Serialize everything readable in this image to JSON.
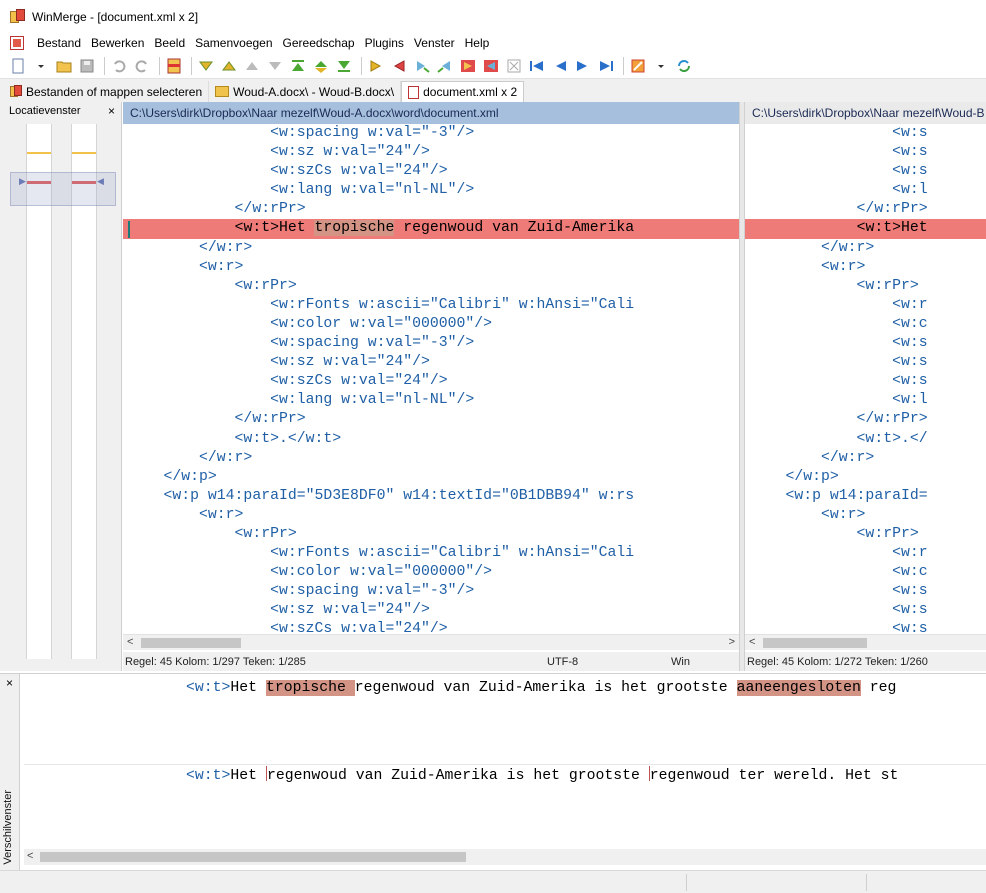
{
  "window": {
    "title": "WinMerge - [document.xml x 2]"
  },
  "menu": [
    "Bestand",
    "Bewerken",
    "Beeld",
    "Samenvoegen",
    "Gereedschap",
    "Plugins",
    "Venster",
    "Help"
  ],
  "tabs": [
    {
      "label": "Bestanden of mappen selecteren",
      "icon": "winmerge-icon"
    },
    {
      "label": "Woud-A.docx\\ - Woud-B.docx\\",
      "icon": "folder-icon"
    },
    {
      "label": "document.xml x 2",
      "icon": "document-icon",
      "active": true
    }
  ],
  "location_pane": {
    "title": "Locatievenster",
    "close": "×"
  },
  "left": {
    "path": "C:\\Users\\dirk\\Dropbox\\Naar mezelf\\Woud-A.docx\\word\\document.xml",
    "lines": [
      "                <w:spacing w:val=\"-3\"/>",
      "                <w:sz w:val=\"24\"/>",
      "                <w:szCs w:val=\"24\"/>",
      "                <w:lang w:val=\"nl-NL\"/>",
      "            </w:rPr>",
      "",
      "        </w:r>",
      "        <w:r>",
      "            <w:rPr>",
      "                <w:rFonts w:ascii=\"Calibri\" w:hAnsi=\"Cali",
      "                <w:color w:val=\"000000\"/>",
      "                <w:spacing w:val=\"-3\"/>",
      "                <w:sz w:val=\"24\"/>",
      "                <w:szCs w:val=\"24\"/>",
      "                <w:lang w:val=\"nl-NL\"/>",
      "            </w:rPr>",
      "            <w:t>.</w:t>",
      "        </w:r>",
      "    </w:p>",
      "    <w:p w14:paraId=\"5D3E8DF0\" w14:textId=\"0B1DBB94\" w:rs",
      "        <w:r>",
      "            <w:rPr>",
      "                <w:rFonts w:ascii=\"Calibri\" w:hAnsi=\"Cali",
      "                <w:color w:val=\"000000\"/>",
      "                <w:spacing w:val=\"-3\"/>",
      "                <w:sz w:val=\"24\"/>",
      "                <w:szCs w:val=\"24\"/>"
    ],
    "diff_line": {
      "indent": "            ",
      "pre": "<w:t>Het ",
      "hl": "tropische",
      "post": " regenwoud van Zuid-Amerika"
    },
    "status": {
      "pos": "Regel: 45  Kolom: 1/297  Teken: 1/285",
      "encoding": "UTF-8",
      "eol": "Win"
    }
  },
  "right": {
    "path": "C:\\Users\\dirk\\Dropbox\\Naar mezelf\\Woud-B",
    "lines": [
      "                <w:s",
      "                <w:s",
      "                <w:s",
      "                <w:l",
      "            </w:rPr>",
      "",
      "        </w:r>",
      "        <w:r>",
      "            <w:rPr>",
      "                <w:r",
      "                <w:c",
      "                <w:s",
      "                <w:s",
      "                <w:s",
      "                <w:l",
      "            </w:rPr>",
      "            <w:t>.</",
      "        </w:r>",
      "    </w:p>",
      "    <w:p w14:paraId=",
      "        <w:r>",
      "            <w:rPr>",
      "                <w:r",
      "                <w:c",
      "                <w:s",
      "                <w:s",
      "                <w:s"
    ],
    "diff_line": {
      "indent": "            ",
      "text": "<w:t>Het"
    },
    "status": {
      "pos": "Regel: 45  Kolom: 1/272  Teken: 1/260"
    }
  },
  "diff_pane": {
    "title": "Verschilvenster",
    "close": "×",
    "top": {
      "tag": "<w:t>",
      "a": "Het ",
      "hl1": "tropische ",
      "b": "regenwoud van Zuid-Amerika is het grootste ",
      "hl2": "aaneengesloten",
      "c": " reg"
    },
    "bottom": {
      "tag": "<w:t>",
      "a": "Het ",
      "b": "regenwoud van Zuid-Amerika is het grootste ",
      "c": "regenwoud ter wereld. Het st"
    }
  },
  "toolbar": [
    "new",
    "open",
    "save",
    "undo",
    "redo",
    "diffpane",
    "next-diff",
    "prev-diff",
    "first-diff",
    "current-diff",
    "last-diff",
    "copy-right",
    "copy-left",
    "copy-right-advance",
    "copy-left-advance",
    "all-right",
    "all-left",
    "collapse",
    "first-file",
    "prev-file",
    "next-file",
    "last-file",
    "options",
    "refresh"
  ],
  "colors": {
    "diff_line": "#ef7b78",
    "word_diff": "#d39486",
    "header_active": "#a5bfdd",
    "tag_text": "#1f5fa6"
  }
}
